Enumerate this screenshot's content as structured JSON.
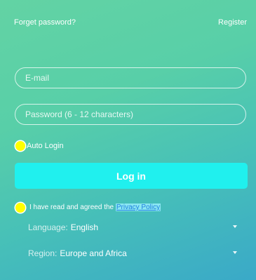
{
  "header": {
    "forget_password": "Forget password?",
    "register": "Register"
  },
  "form": {
    "email_placeholder": "E-mail",
    "password_placeholder": "Password (6 - 12 characters)",
    "auto_login_label": "Auto Login",
    "login_button": "Log in",
    "agree_text": "I have read and agreed the",
    "privacy_link": "Privacy Policy"
  },
  "settings": {
    "language_label": "Language:",
    "language_value": "English",
    "region_label": "Region:",
    "region_value": "Europe and Africa"
  },
  "colors": {
    "radio": "#ffff00",
    "button": "#20f0ee",
    "link": "#1e7fe0"
  }
}
